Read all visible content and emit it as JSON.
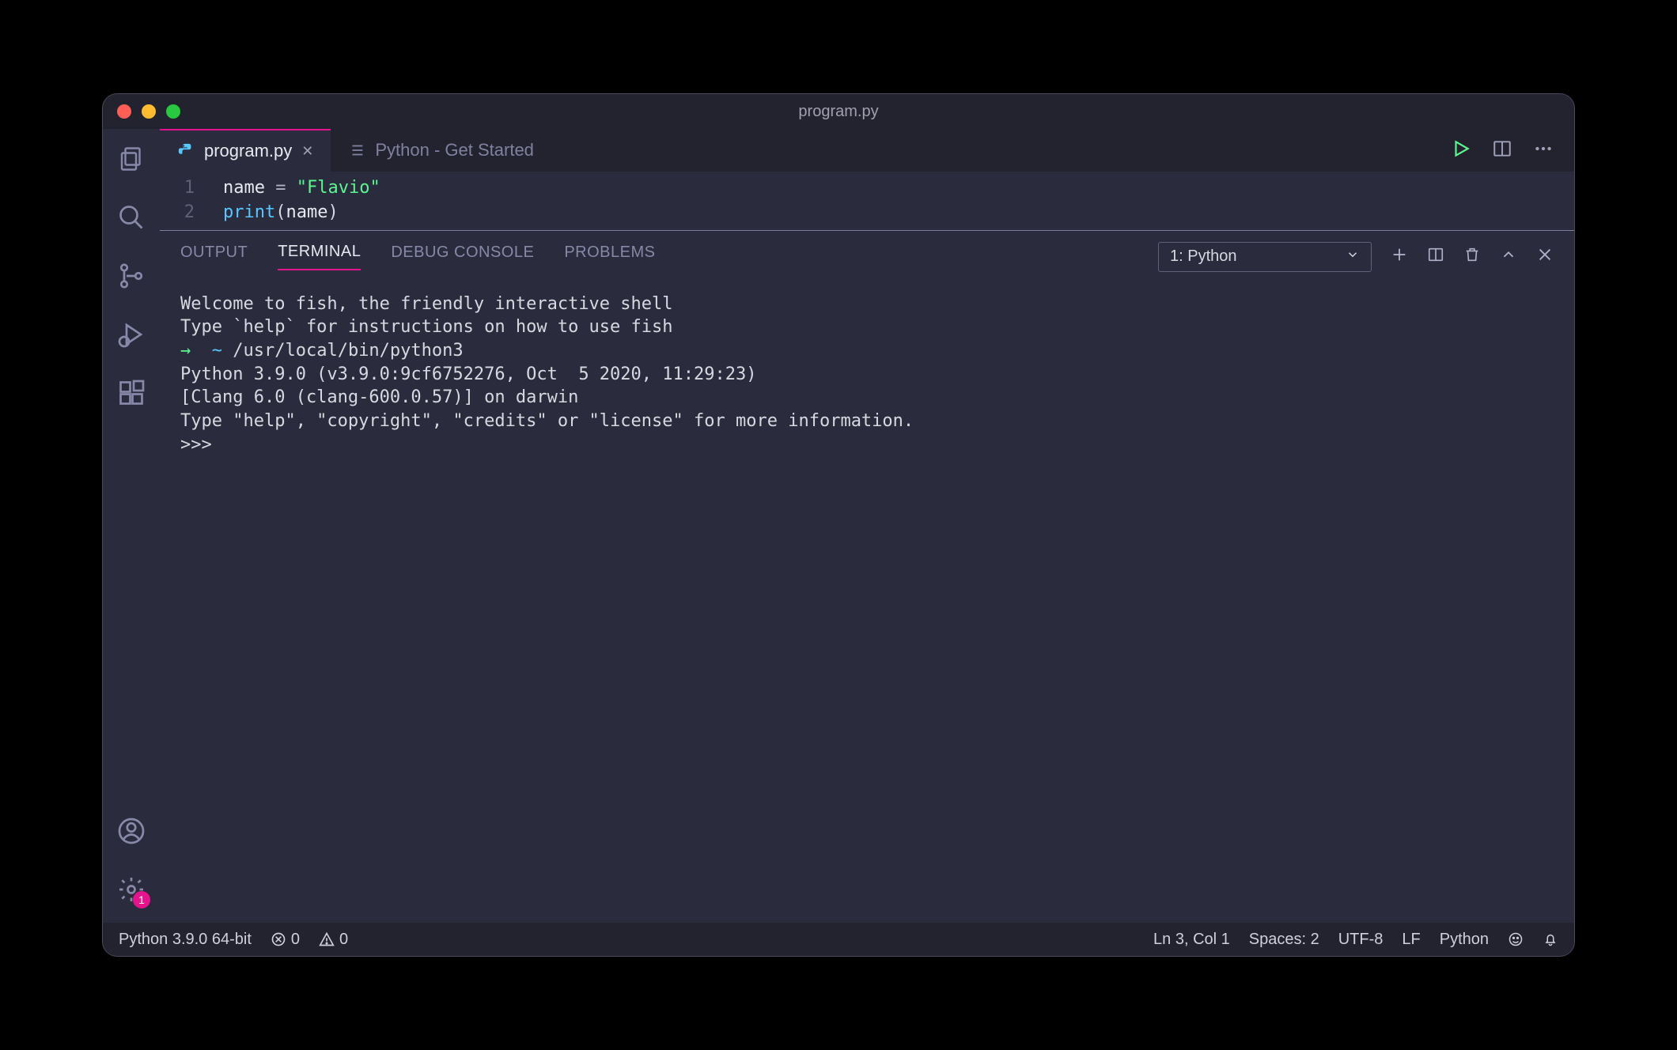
{
  "window": {
    "title": "program.py"
  },
  "tabs": {
    "0": {
      "label": "program.py",
      "is_active": true
    },
    "1": {
      "label": "Python - Get Started",
      "is_active": false
    }
  },
  "editor": {
    "lines": {
      "0": {
        "num": "1",
        "content_var": "name",
        "content_op": " = ",
        "content_str": "\"Flavio\""
      },
      "1": {
        "num": "2",
        "content_fn": "print",
        "content_paren_open": "(",
        "content_arg": "name",
        "content_paren_close": ")"
      }
    }
  },
  "panel": {
    "tabs": {
      "output": "OUTPUT",
      "terminal": "TERMINAL",
      "debug_console": "DEBUG CONSOLE",
      "problems": "PROBLEMS"
    },
    "selector": "1: Python"
  },
  "terminal": {
    "line0": "Welcome to fish, the friendly interactive shell",
    "line1": "Type `help` for instructions on how to use fish",
    "prompt_arrow": "→",
    "prompt_tilde": "~",
    "prompt_cmd": "/usr/local/bin/python3",
    "line3": "Python 3.9.0 (v3.9.0:9cf6752276, Oct  5 2020, 11:29:23)",
    "line4": "[Clang 6.0 (clang-600.0.57)] on darwin",
    "line5": "Type \"help\", \"copyright\", \"credits\" or \"license\" for more information.",
    "line6": ">>>"
  },
  "status": {
    "interpreter": "Python 3.9.0 64-bit",
    "errors": "0",
    "warnings": "0",
    "ln_col": "Ln 3, Col 1",
    "spaces": "Spaces: 2",
    "encoding": "UTF-8",
    "eol": "LF",
    "language": "Python"
  },
  "settings_badge": "1"
}
